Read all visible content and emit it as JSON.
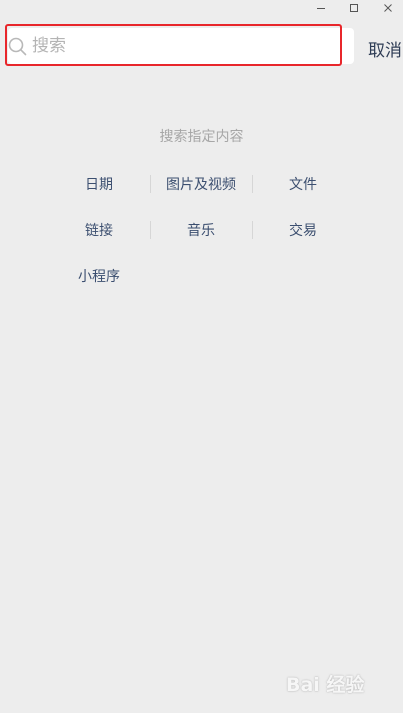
{
  "window": {
    "controls": [
      "minimize-icon",
      "maximize-icon",
      "close-icon"
    ]
  },
  "search": {
    "placeholder": "搜索",
    "value": "",
    "cancel_label": "取消",
    "highlight_color": "#e8262b"
  },
  "section": {
    "title": "搜索指定内容",
    "rows": [
      [
        "日期",
        "图片及视频",
        "文件"
      ],
      [
        "链接",
        "音乐",
        "交易"
      ],
      [
        "小程序"
      ]
    ]
  },
  "watermark": {
    "text": "Bai 经验"
  },
  "colors": {
    "background": "#ededed",
    "link": "#3c4f70",
    "muted": "#a7a7a7"
  }
}
